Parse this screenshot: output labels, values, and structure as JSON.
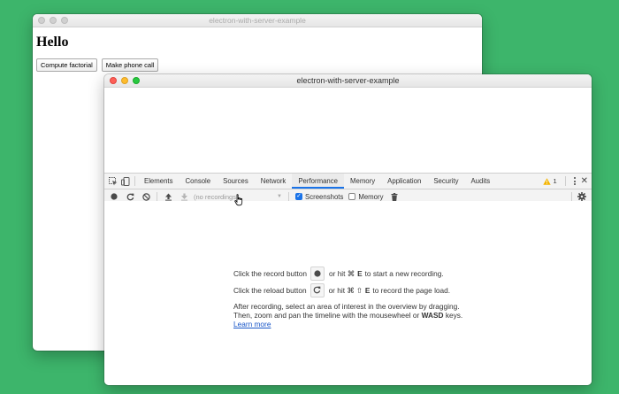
{
  "back_window": {
    "title": "electron-with-server-example",
    "heading": "Hello",
    "buttons": [
      "Compute factorial",
      "Make phone call"
    ]
  },
  "devtools_window": {
    "title": "electron-with-server-example",
    "tabs": [
      "Elements",
      "Console",
      "Sources",
      "Network",
      "Performance",
      "Memory",
      "Application",
      "Security",
      "Audits"
    ],
    "active_tab": "Performance",
    "warning_count": "1",
    "toolbar": {
      "recordings_placeholder": "(no recordings)",
      "screenshots_label": "Screenshots",
      "memory_label": "Memory"
    },
    "instructions": {
      "record_before": "Click the record button",
      "record_after_prefix": "or hit ⌘",
      "record_key": "E",
      "record_after_suffix": "to start a new recording.",
      "reload_before": "Click the reload button",
      "reload_after_prefix": "or hit ⌘ ⇧",
      "reload_key": "E",
      "reload_after_suffix": "to record the page load.",
      "para_line1": "After recording, select an area of interest in the overview by dragging.",
      "para_line2_prefix": "Then, zoom and pan the timeline with the mousewheel or",
      "para_line2_bold": "WASD",
      "para_line2_suffix": "keys.",
      "learn_more": "Learn more"
    }
  },
  "colors": {
    "background": "#3db56b",
    "accent": "#1a73e8",
    "link": "#1a57c8"
  }
}
